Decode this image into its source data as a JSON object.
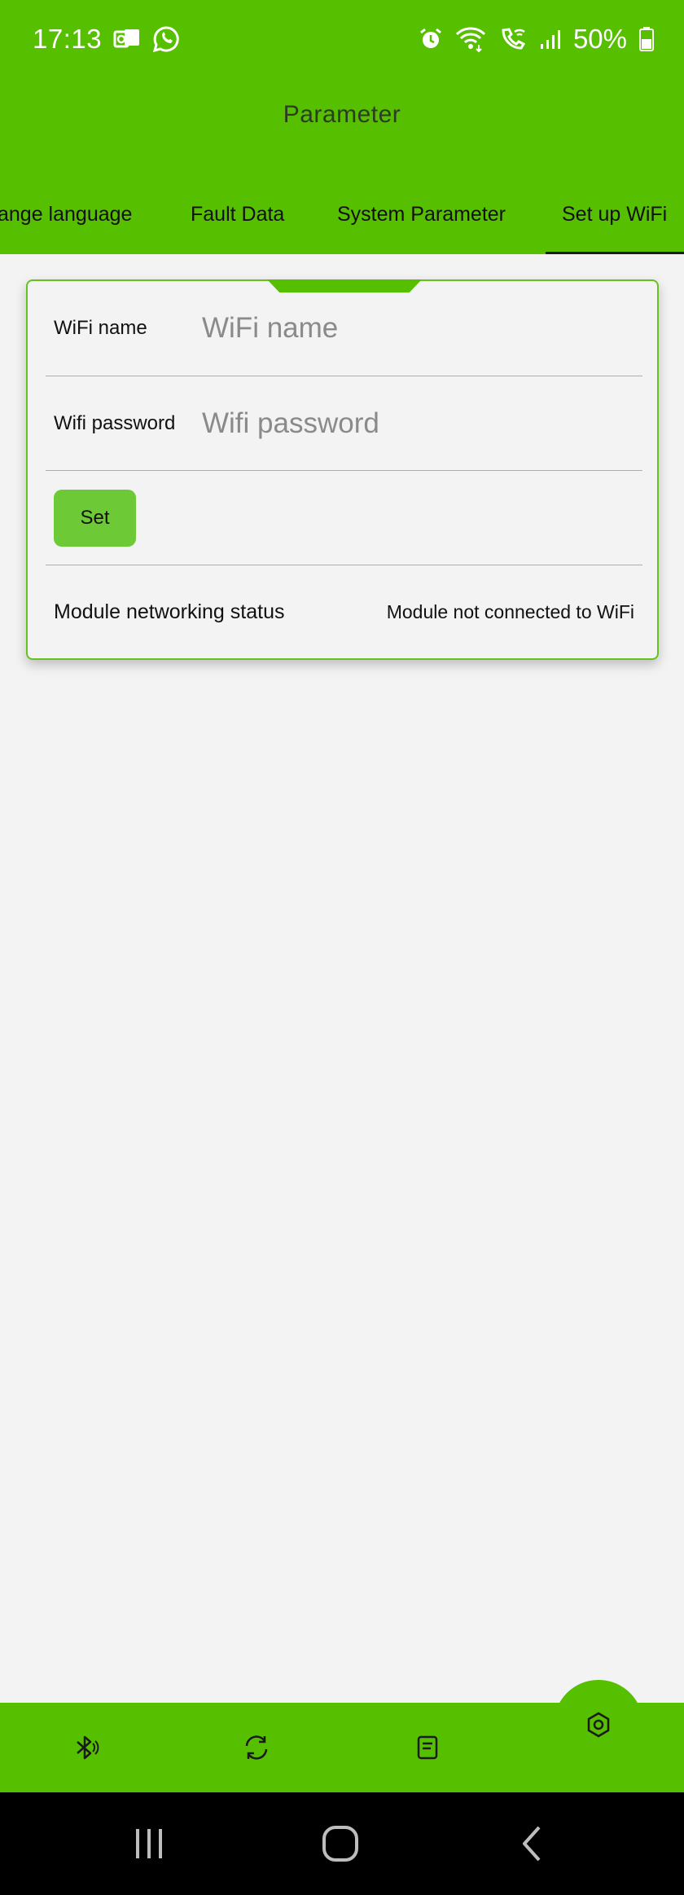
{
  "status_bar": {
    "time": "17:13",
    "battery": "50%",
    "left_icons": [
      "outlook-icon",
      "whatsapp-icon"
    ],
    "right_icons": [
      "alarm-icon",
      "wifi-icon",
      "wifi-call-icon",
      "signal-icon",
      "battery-icon"
    ]
  },
  "header": {
    "title": "Parameter",
    "tabs": [
      {
        "label": "ange language"
      },
      {
        "label": "Fault Data"
      },
      {
        "label": "System Parameter"
      },
      {
        "label": "Set up WiFi",
        "active": true
      }
    ]
  },
  "wifi_form": {
    "name_label": "WiFi name",
    "name_placeholder": "WiFi name",
    "name_value": "",
    "password_label": "Wifi password",
    "password_placeholder": "Wifi password",
    "password_value": "",
    "set_label": "Set",
    "status_label": "Module networking status",
    "status_value": "Module not connected to WiFi"
  },
  "bottom_nav": {
    "items": [
      "bluetooth-icon",
      "refresh-icon",
      "document-icon",
      "settings-icon"
    ],
    "active": "settings-icon"
  },
  "colors": {
    "brand_green": "#55bf00",
    "button_green": "#6dc935",
    "background": "#f3f3f3"
  }
}
